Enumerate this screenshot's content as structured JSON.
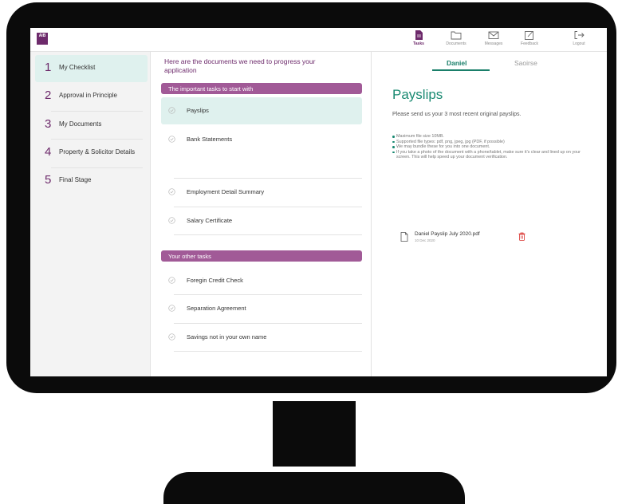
{
  "app": {
    "logo_text": "AIB"
  },
  "nav": [
    {
      "label": "Tasks",
      "icon": "tasks-icon",
      "active": true
    },
    {
      "label": "Documents",
      "icon": "folder-icon",
      "active": false
    },
    {
      "label": "Messages",
      "icon": "mail-icon",
      "active": false
    },
    {
      "label": "Feedback",
      "icon": "feedback-icon",
      "active": false
    },
    {
      "label": "Logout",
      "icon": "logout-icon",
      "active": false
    }
  ],
  "sidebar": {
    "items": [
      {
        "number": "1",
        "label": "My Checklist",
        "active": true
      },
      {
        "number": "2",
        "label": "Approval in Principle",
        "active": false
      },
      {
        "number": "3",
        "label": "My Documents",
        "active": false
      },
      {
        "number": "4",
        "label": "Property & Solicitor Details",
        "active": false
      },
      {
        "number": "5",
        "label": "Final Stage",
        "active": false
      }
    ]
  },
  "checklist": {
    "intro": "Here are the documents we need to progress your application",
    "important_header": "The important tasks to start with",
    "important_tasks": [
      {
        "label": "Payslips",
        "active": true
      },
      {
        "label": "Bank Statements",
        "active": false
      },
      {
        "label": "Employment Detail Summary",
        "active": false
      },
      {
        "label": "Salary Certificate",
        "active": false
      }
    ],
    "other_header": "Your other tasks",
    "other_tasks": [
      {
        "label": "Foregin Credit Check"
      },
      {
        "label": "Separation Agreement"
      },
      {
        "label": "Savings not in your own name"
      }
    ]
  },
  "detail": {
    "person_tabs": [
      {
        "label": "Daniel",
        "active": true
      },
      {
        "label": "Saoirse",
        "active": false
      }
    ],
    "title": "Payslips",
    "description": "Please send us your 3 most recent original payslips.",
    "rules": [
      "Maximum file size 10MB.",
      "Supported file types: pdf, png, jpeg, jpg (PDF, if possible)",
      "We may bundle these for you into one document.",
      "If you take a photo of the document with a phone/tablet, make sure it's clear and lined up on your screen. This will help speed up your document verification."
    ],
    "file": {
      "name": "Daniel Payslip July 2020.pdf",
      "date": "10 Dec 2020"
    }
  },
  "colors": {
    "brand": "#6d2a6b",
    "section_bar": "#a15a97",
    "teal": "#1a8a72",
    "active_bg": "#dff1ee",
    "delete": "#d9302c"
  }
}
